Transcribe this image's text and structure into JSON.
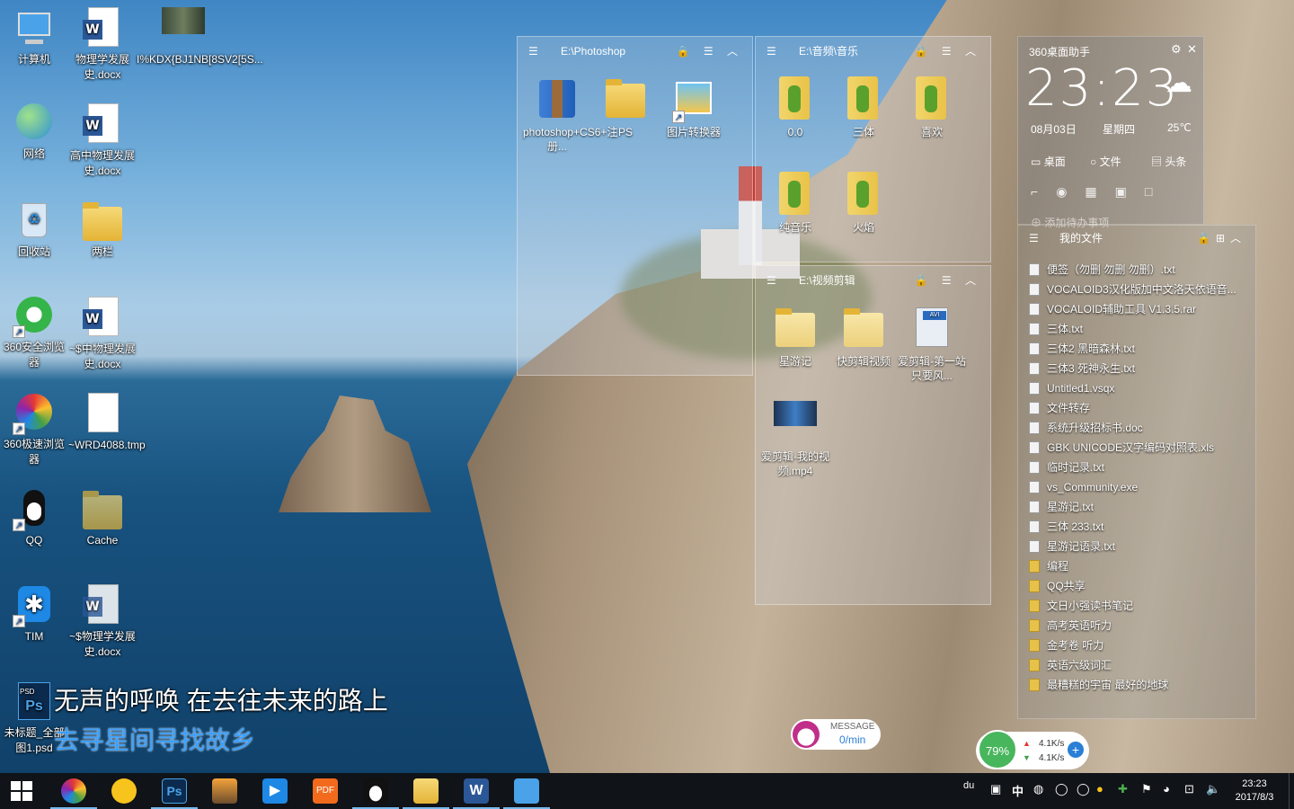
{
  "desktop_icons": [
    {
      "label": "计算机"
    },
    {
      "label": "物理学发展史.docx"
    },
    {
      "label": "I%KDX{BJ1NB[8SV2[5S..."
    },
    {
      "label": "网络"
    },
    {
      "label": "高中物理发展史.docx"
    },
    {
      "label": "回收站"
    },
    {
      "label": "两栏"
    },
    {
      "label": "360安全浏览器"
    },
    {
      "label": "~$中物理发展史.docx"
    },
    {
      "label": "360极速浏览器"
    },
    {
      "label": "~WRD4088.tmp"
    },
    {
      "label": "QQ"
    },
    {
      "label": "Cache"
    },
    {
      "label": "TIM"
    },
    {
      "label": "~$物理学发展史.docx"
    },
    {
      "label": "未标题_全部图1.psd"
    }
  ],
  "lyrics": {
    "line1": "无声的呼唤  在去往未来的路上",
    "line2": "去寻星间寻找故乡"
  },
  "fences": [
    {
      "title": "E:\\Photoshop",
      "tools": "🔒 ☰ ︿",
      "items": [
        {
          "label": "photoshop+CS6+注册..."
        },
        {
          "label": "PS"
        },
        {
          "label": "图片转换器"
        }
      ]
    },
    {
      "title": "E:\\音频\\音乐",
      "tools": "🔒 ☰ ︿",
      "items": [
        {
          "label": "0.0"
        },
        {
          "label": "三体"
        },
        {
          "label": "喜欢"
        },
        {
          "label": "纯音乐"
        },
        {
          "label": "火焰"
        }
      ]
    },
    {
      "title": "E:\\视频剪辑",
      "tools": "🔒 ☰ ︿",
      "items": [
        {
          "label": "星游记"
        },
        {
          "label": "快剪辑视频"
        },
        {
          "label": "爱剪辑-第一站 只要风..."
        },
        {
          "label": "爱剪辑-我的视频.mp4"
        }
      ]
    }
  ],
  "assistant": {
    "title": "360桌面助手",
    "time": "23:23",
    "date": "08月03日",
    "weekday": "星期四",
    "temp": "25℃",
    "tabs": [
      "桌面",
      "文件",
      "头条"
    ],
    "add_text": "添加待办事项"
  },
  "myfiles": {
    "title": "我的文件",
    "files": [
      {
        "name": "便签（勿删 勿删 勿删）.txt",
        "type": "file"
      },
      {
        "name": "VOCALOID3汉化版加中文洛天依语音...",
        "type": "file"
      },
      {
        "name": "VOCALOID辅助工具 V1.3.5.rar",
        "type": "file"
      },
      {
        "name": "三体.txt",
        "type": "file"
      },
      {
        "name": "三体2 黑暗森林.txt",
        "type": "file"
      },
      {
        "name": "三体3 死神永生.txt",
        "type": "file"
      },
      {
        "name": "Untitled1.vsqx",
        "type": "file"
      },
      {
        "name": "文件转存",
        "type": "file"
      },
      {
        "name": "系统升级招标书.doc",
        "type": "file"
      },
      {
        "name": "GBK UNICODE汉字编码对照表.xls",
        "type": "file"
      },
      {
        "name": "临时记录.txt",
        "type": "file"
      },
      {
        "name": "vs_Community.exe",
        "type": "file"
      },
      {
        "name": "星游记.txt",
        "type": "file"
      },
      {
        "name": "三体 233.txt",
        "type": "file"
      },
      {
        "name": "星游记语录.txt",
        "type": "file"
      },
      {
        "name": "编程",
        "type": "folder"
      },
      {
        "name": "QQ共享",
        "type": "folder"
      },
      {
        "name": "文日小强读书笔记",
        "type": "folder"
      },
      {
        "name": "高考英语听力",
        "type": "folder"
      },
      {
        "name": "金考卷 听力",
        "type": "folder"
      },
      {
        "name": "英语六级词汇",
        "type": "folder"
      },
      {
        "name": "最糟糕的宇宙 最好的地球",
        "type": "folder"
      }
    ]
  },
  "message": {
    "label": "MESSAGE",
    "rate": "0/min"
  },
  "net": {
    "percent": "79%",
    "up": "4.1K/s",
    "down": "4.1K/s"
  },
  "taskbar": {
    "clock_time": "23:23",
    "clock_date": "2017/8/3",
    "ime": "中"
  },
  "colors": {
    "taskbar": "#101318",
    "accent": "#76b9ed"
  }
}
